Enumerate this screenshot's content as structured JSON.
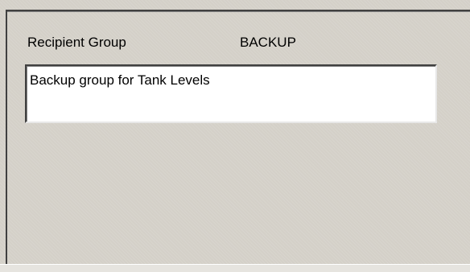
{
  "recipient_group": {
    "label": "Recipient Group",
    "name": "BACKUP",
    "description": "Backup group for Tank Levels"
  }
}
